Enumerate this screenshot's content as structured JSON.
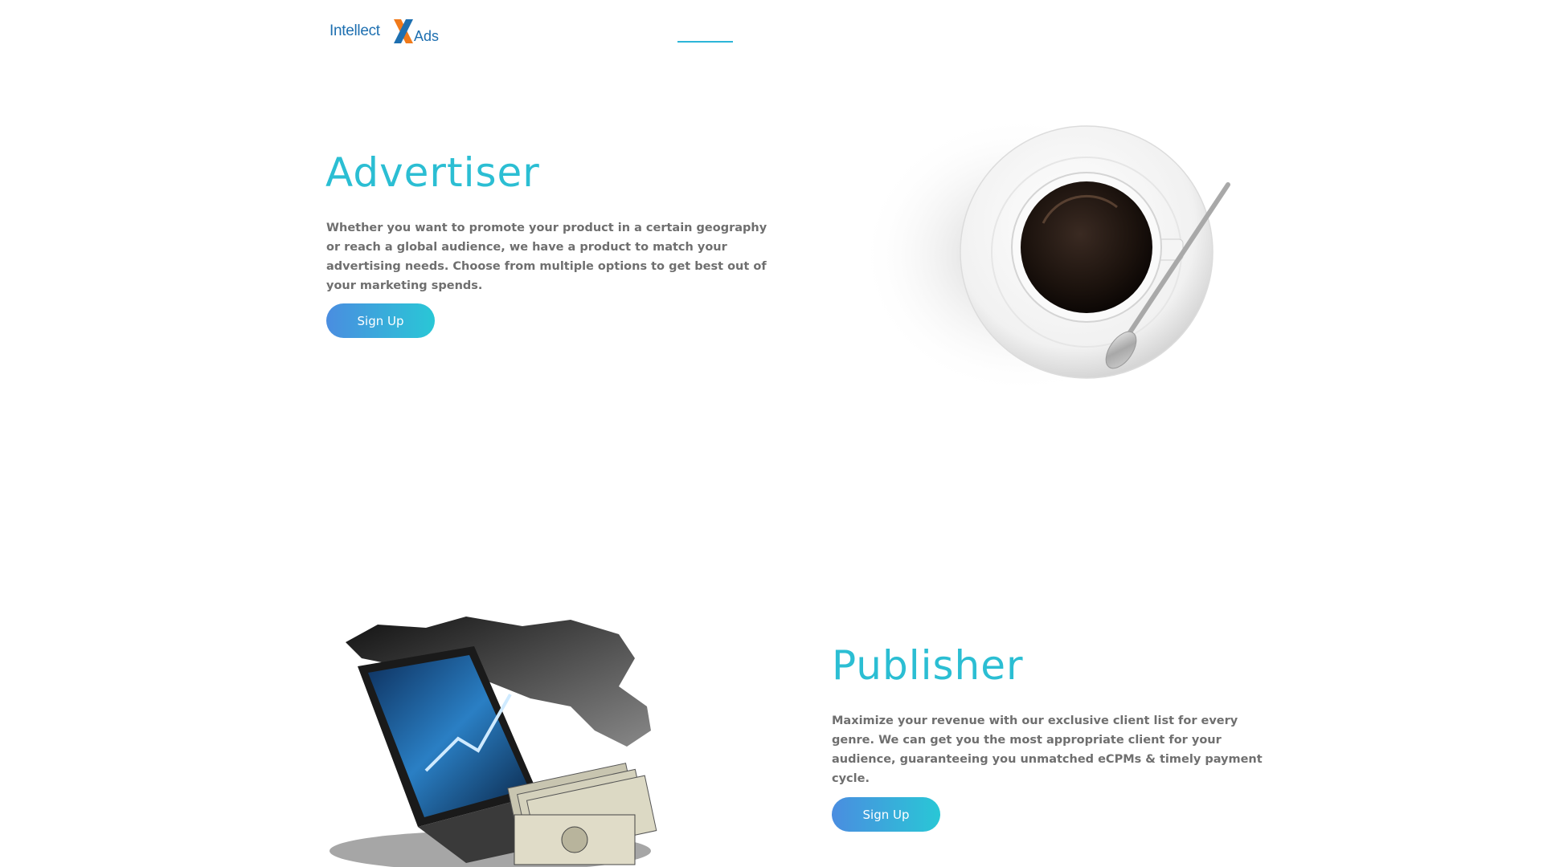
{
  "header": {
    "logo": {
      "part1": "Intellect",
      "part2": "Ads"
    }
  },
  "advertiser": {
    "title": "Advertiser",
    "description": "Whether you want to promote your product in a certain geography or reach a global audience, we have a product to match your advertising needs. Choose from multiple options to get best out of your marketing spends.",
    "button_label": "Sign Up"
  },
  "publisher": {
    "title": "Publisher",
    "description": "Maximize your revenue with our exclusive client list for every genre. We can get you the most appropriate client for your audience, guaranteeing you unmatched eCPMs & timely payment cycle.",
    "button_label": "Sign Up"
  },
  "colors": {
    "accent": "#2bbed3",
    "button_gradient_start": "#4a8de0",
    "button_gradient_end": "#29c7d6",
    "body_text": "#6f6f6f",
    "logo_blue": "#1d6fb0",
    "logo_orange": "#f07a1a"
  },
  "icons": {
    "logo": "intellectx-logo",
    "advertiser_image": "coffee-cup-image",
    "publisher_image": "laptop-money-world-map-image"
  }
}
